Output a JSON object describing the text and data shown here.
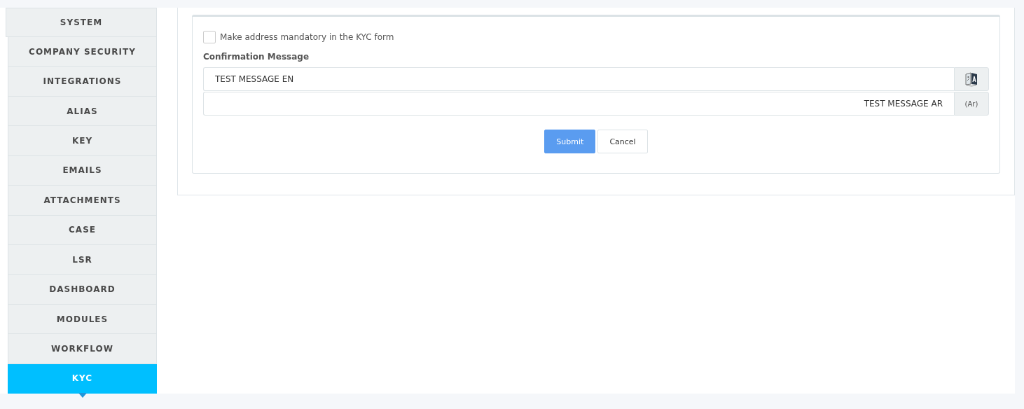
{
  "sidebar": {
    "header": "SYSTEM",
    "items": [
      {
        "label": "COMPANY SECURITY",
        "selected": false
      },
      {
        "label": "INTEGRATIONS",
        "selected": false
      },
      {
        "label": "ALIAS",
        "selected": false
      },
      {
        "label": "KEY",
        "selected": false
      },
      {
        "label": "EMAILS",
        "selected": false
      },
      {
        "label": "ATTACHMENTS",
        "selected": false
      },
      {
        "label": "CASE",
        "selected": false
      },
      {
        "label": "LSR",
        "selected": false
      },
      {
        "label": "DASHBOARD",
        "selected": false
      },
      {
        "label": "MODULES",
        "selected": false
      },
      {
        "label": "WORKFLOW",
        "selected": false
      },
      {
        "label": "KYC",
        "selected": true
      }
    ]
  },
  "form": {
    "checkbox": {
      "label": "Make address mandatory in the KYC form",
      "checked": false
    },
    "message_label": "Confirmation Message",
    "fields": [
      {
        "value": "TEST MESSAGE EN",
        "kind": "translate"
      },
      {
        "value": "TEST MESSAGE AR",
        "kind": "arabic",
        "addon": "(Ar)"
      }
    ],
    "buttons": [
      {
        "label": "Submit",
        "kind": "primary"
      },
      {
        "label": "Cancel",
        "kind": "default"
      }
    ]
  }
}
